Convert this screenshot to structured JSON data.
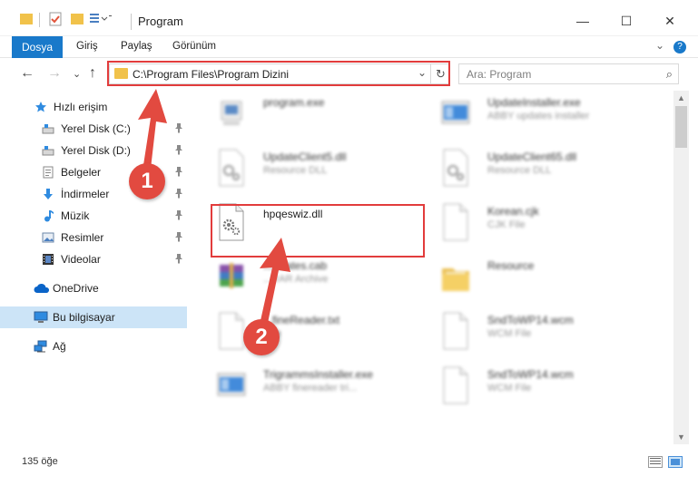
{
  "titlebar": {
    "title": "Program",
    "quick_access_icons": [
      "folder-icon",
      "properties-check-icon",
      "new-folder-icon",
      "customize-icon"
    ],
    "minimize_glyph": "—",
    "maximize_glyph": "☐",
    "close_glyph": "✕"
  },
  "ribbon": {
    "file_tab": "Dosya",
    "tabs": [
      "Giriş",
      "Paylaş",
      "Görünüm"
    ],
    "collapse_glyph": "⌄",
    "help_glyph": "?"
  },
  "nav": {
    "back_glyph": "←",
    "forward_glyph": "→",
    "recent_glyph": "⌄",
    "up_glyph": "↑",
    "address": "C:\\Program Files\\Program Dizini",
    "dropdown_glyph": "⌄",
    "refresh_glyph": "↻",
    "search_placeholder": "Ara: Program",
    "search_glyph": "⌕"
  },
  "sidebar": {
    "items": [
      {
        "label": "Hızlı erişim",
        "icon": "star-icon",
        "pinned": false
      },
      {
        "label": "Yerel Disk (C:)",
        "icon": "drive-icon",
        "pinned": true
      },
      {
        "label": "Yerel Disk (D:)",
        "icon": "drive-icon",
        "pinned": true
      },
      {
        "label": "Belgeler",
        "icon": "documents-icon",
        "pinned": true
      },
      {
        "label": "İndirmeler",
        "icon": "download-icon",
        "pinned": true
      },
      {
        "label": "Müzik",
        "icon": "music-icon",
        "pinned": true
      },
      {
        "label": "Resimler",
        "icon": "pictures-icon",
        "pinned": true
      },
      {
        "label": "Videolar",
        "icon": "videos-icon",
        "pinned": true
      },
      {
        "label": "OneDrive",
        "icon": "cloud-icon",
        "pinned": false
      },
      {
        "label": "Bu bilgisayar",
        "icon": "computer-icon",
        "pinned": false
      },
      {
        "label": "Ağ",
        "icon": "network-icon",
        "pinned": false
      }
    ],
    "pin_glyph": "📌"
  },
  "files": [
    {
      "name": "program.exe",
      "sub": "",
      "icon": "exe-icon",
      "blurred": true
    },
    {
      "name": "UpdateInstaller.exe",
      "sub": "ABBY updates installer",
      "icon": "installer-icon",
      "blurred": true
    },
    {
      "name": "UpdateClient5.dll",
      "sub": "Resource DLL",
      "icon": "dll-icon",
      "blurred": true
    },
    {
      "name": "UpdateClient65.dll",
      "sub": "Resource DLL",
      "icon": "dll-icon",
      "blurred": true
    },
    {
      "name": "hpqeswiz.dll",
      "sub": "",
      "icon": "dll-gear-icon",
      "blurred": false
    },
    {
      "name": "Korean.cjk",
      "sub": "CJK File",
      "icon": "blank-file-icon",
      "blurred": true
    },
    {
      "name": "...ificates.cab",
      "sub": "...RAR Archive",
      "icon": "winrar-icon",
      "blurred": true
    },
    {
      "name": "Resource",
      "sub": "",
      "icon": "folder-icon",
      "blurred": true
    },
    {
      "name": "...fineReader.txt",
      "sub": "...ile",
      "icon": "text-file-icon",
      "blurred": true
    },
    {
      "name": "SndToWP14.wcm",
      "sub": "WCM File",
      "icon": "blank-file-icon",
      "blurred": true
    },
    {
      "name": "TrigrammsInstaller.exe",
      "sub": "ABBY finereader tri...",
      "icon": "installer-icon",
      "blurred": true
    },
    {
      "name": "SndToWP14.wcm",
      "sub": "WCM File",
      "icon": "blank-file-icon",
      "blurred": true
    }
  ],
  "status": {
    "count": "135 öğe"
  },
  "annotations": {
    "step1": "1",
    "step2": "2",
    "color": "#e24a40"
  }
}
